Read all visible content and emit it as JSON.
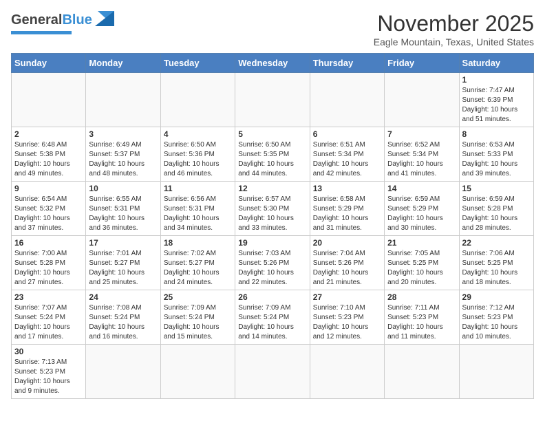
{
  "header": {
    "logo": {
      "general": "General",
      "blue": "Blue"
    },
    "title": "November 2025",
    "location": "Eagle Mountain, Texas, United States"
  },
  "weekdays": [
    "Sunday",
    "Monday",
    "Tuesday",
    "Wednesday",
    "Thursday",
    "Friday",
    "Saturday"
  ],
  "weeks": [
    [
      {
        "day": "",
        "info": ""
      },
      {
        "day": "",
        "info": ""
      },
      {
        "day": "",
        "info": ""
      },
      {
        "day": "",
        "info": ""
      },
      {
        "day": "",
        "info": ""
      },
      {
        "day": "",
        "info": ""
      },
      {
        "day": "1",
        "info": "Sunrise: 7:47 AM\nSunset: 6:39 PM\nDaylight: 10 hours and 51 minutes."
      }
    ],
    [
      {
        "day": "2",
        "info": "Sunrise: 6:48 AM\nSunset: 5:38 PM\nDaylight: 10 hours and 49 minutes."
      },
      {
        "day": "3",
        "info": "Sunrise: 6:49 AM\nSunset: 5:37 PM\nDaylight: 10 hours and 48 minutes."
      },
      {
        "day": "4",
        "info": "Sunrise: 6:50 AM\nSunset: 5:36 PM\nDaylight: 10 hours and 46 minutes."
      },
      {
        "day": "5",
        "info": "Sunrise: 6:50 AM\nSunset: 5:35 PM\nDaylight: 10 hours and 44 minutes."
      },
      {
        "day": "6",
        "info": "Sunrise: 6:51 AM\nSunset: 5:34 PM\nDaylight: 10 hours and 42 minutes."
      },
      {
        "day": "7",
        "info": "Sunrise: 6:52 AM\nSunset: 5:34 PM\nDaylight: 10 hours and 41 minutes."
      },
      {
        "day": "8",
        "info": "Sunrise: 6:53 AM\nSunset: 5:33 PM\nDaylight: 10 hours and 39 minutes."
      }
    ],
    [
      {
        "day": "9",
        "info": "Sunrise: 6:54 AM\nSunset: 5:32 PM\nDaylight: 10 hours and 37 minutes."
      },
      {
        "day": "10",
        "info": "Sunrise: 6:55 AM\nSunset: 5:31 PM\nDaylight: 10 hours and 36 minutes."
      },
      {
        "day": "11",
        "info": "Sunrise: 6:56 AM\nSunset: 5:31 PM\nDaylight: 10 hours and 34 minutes."
      },
      {
        "day": "12",
        "info": "Sunrise: 6:57 AM\nSunset: 5:30 PM\nDaylight: 10 hours and 33 minutes."
      },
      {
        "day": "13",
        "info": "Sunrise: 6:58 AM\nSunset: 5:29 PM\nDaylight: 10 hours and 31 minutes."
      },
      {
        "day": "14",
        "info": "Sunrise: 6:59 AM\nSunset: 5:29 PM\nDaylight: 10 hours and 30 minutes."
      },
      {
        "day": "15",
        "info": "Sunrise: 6:59 AM\nSunset: 5:28 PM\nDaylight: 10 hours and 28 minutes."
      }
    ],
    [
      {
        "day": "16",
        "info": "Sunrise: 7:00 AM\nSunset: 5:28 PM\nDaylight: 10 hours and 27 minutes."
      },
      {
        "day": "17",
        "info": "Sunrise: 7:01 AM\nSunset: 5:27 PM\nDaylight: 10 hours and 25 minutes."
      },
      {
        "day": "18",
        "info": "Sunrise: 7:02 AM\nSunset: 5:27 PM\nDaylight: 10 hours and 24 minutes."
      },
      {
        "day": "19",
        "info": "Sunrise: 7:03 AM\nSunset: 5:26 PM\nDaylight: 10 hours and 22 minutes."
      },
      {
        "day": "20",
        "info": "Sunrise: 7:04 AM\nSunset: 5:26 PM\nDaylight: 10 hours and 21 minutes."
      },
      {
        "day": "21",
        "info": "Sunrise: 7:05 AM\nSunset: 5:25 PM\nDaylight: 10 hours and 20 minutes."
      },
      {
        "day": "22",
        "info": "Sunrise: 7:06 AM\nSunset: 5:25 PM\nDaylight: 10 hours and 18 minutes."
      }
    ],
    [
      {
        "day": "23",
        "info": "Sunrise: 7:07 AM\nSunset: 5:24 PM\nDaylight: 10 hours and 17 minutes."
      },
      {
        "day": "24",
        "info": "Sunrise: 7:08 AM\nSunset: 5:24 PM\nDaylight: 10 hours and 16 minutes."
      },
      {
        "day": "25",
        "info": "Sunrise: 7:09 AM\nSunset: 5:24 PM\nDaylight: 10 hours and 15 minutes."
      },
      {
        "day": "26",
        "info": "Sunrise: 7:09 AM\nSunset: 5:24 PM\nDaylight: 10 hours and 14 minutes."
      },
      {
        "day": "27",
        "info": "Sunrise: 7:10 AM\nSunset: 5:23 PM\nDaylight: 10 hours and 12 minutes."
      },
      {
        "day": "28",
        "info": "Sunrise: 7:11 AM\nSunset: 5:23 PM\nDaylight: 10 hours and 11 minutes."
      },
      {
        "day": "29",
        "info": "Sunrise: 7:12 AM\nSunset: 5:23 PM\nDaylight: 10 hours and 10 minutes."
      }
    ],
    [
      {
        "day": "30",
        "info": "Sunrise: 7:13 AM\nSunset: 5:23 PM\nDaylight: 10 hours and 9 minutes."
      },
      {
        "day": "",
        "info": ""
      },
      {
        "day": "",
        "info": ""
      },
      {
        "day": "",
        "info": ""
      },
      {
        "day": "",
        "info": ""
      },
      {
        "day": "",
        "info": ""
      },
      {
        "day": "",
        "info": ""
      }
    ]
  ]
}
